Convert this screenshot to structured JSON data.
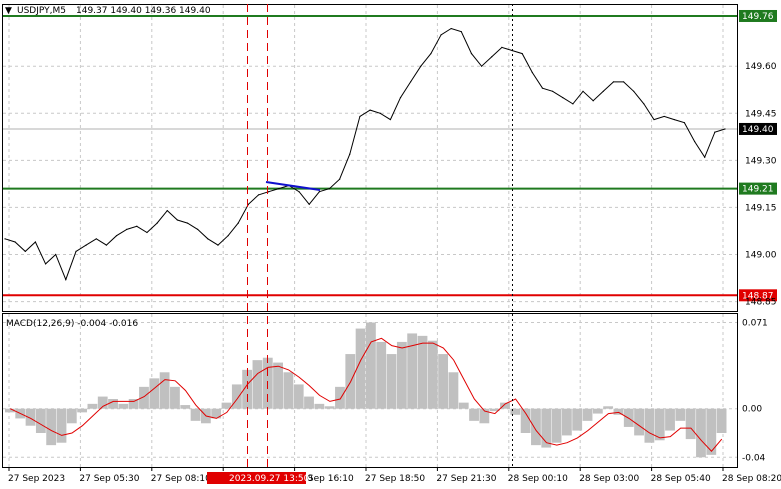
{
  "header": {
    "symbol_label": "USDJPY,M5",
    "ohlc": "149.37 149.40 149.36 149.40",
    "macd_label": "MACD(12,26,9) -0.004 -0.016"
  },
  "price_axis": {
    "ticks": [
      "149.60",
      "149.45",
      "149.30",
      "149.15",
      "149.00",
      "148.85"
    ],
    "tick_values": [
      149.6,
      149.45,
      149.3,
      149.15,
      149.0,
      148.85
    ],
    "range": [
      148.82,
      149.795
    ]
  },
  "macd_axis": {
    "ticks": [
      "0.071",
      "0.00",
      "-0.04"
    ],
    "tick_values": [
      0.071,
      0.0,
      -0.04
    ],
    "range": [
      -0.048,
      0.078
    ]
  },
  "levels": [
    {
      "label": "149.76",
      "value": 149.76,
      "color": "#1f7a1f"
    },
    {
      "label": "149.40",
      "value": 149.4,
      "color": "#000000"
    },
    {
      "label": "149.21",
      "value": 149.21,
      "color": "#1f7a1f"
    },
    {
      "label": "148.87",
      "value": 148.87,
      "color": "#e00000"
    }
  ],
  "time_axis": {
    "labels": [
      "27 Sep 2023",
      "27 Sep 05:30",
      "27 Sep 08:10",
      "27 Sep 202",
      "27 Sep 16:10",
      "27 Sep 18:50",
      "27 Sep 21:30",
      "28 Sep 00:10",
      "28 Sep 03:00",
      "28 Sep 05:40",
      "28 Sep 08:20"
    ],
    "highlight_label": "2023.09.27 13:50",
    "trailing_label": "0"
  },
  "colors": {
    "price_line": "#000000",
    "trendline": "#1010cc",
    "support_resistance": "#1f7a1f",
    "stop_level": "#e00000",
    "histogram": "#c0c0c0",
    "signal": "#e00000",
    "grid": "#c8c8c8"
  },
  "chart_data": [
    {
      "type": "line",
      "title": "USDJPY,M5",
      "x_labels": [
        "27 Sep 2023",
        "27 Sep 05:30",
        "27 Sep 08:10",
        "27 Sep 202",
        "27 Sep 16:10",
        "27 Sep 18:50",
        "27 Sep 21:30",
        "28 Sep 00:10",
        "28 Sep 03:00",
        "28 Sep 05:40",
        "28 Sep 08:20"
      ],
      "series": [
        {
          "name": "USDJPY,M5",
          "values": [
            149.05,
            149.04,
            149.01,
            149.04,
            148.97,
            149.0,
            148.92,
            149.01,
            149.03,
            149.05,
            149.03,
            149.06,
            149.08,
            149.09,
            149.07,
            149.1,
            149.14,
            149.11,
            149.1,
            149.08,
            149.05,
            149.03,
            149.06,
            149.1,
            149.16,
            149.19,
            149.2,
            149.21,
            149.22,
            149.2,
            149.16,
            149.2,
            149.21,
            149.24,
            149.32,
            149.44,
            149.46,
            149.45,
            149.43,
            149.5,
            149.55,
            149.6,
            149.64,
            149.7,
            149.72,
            149.71,
            149.64,
            149.6,
            149.63,
            149.66,
            149.65,
            149.64,
            149.58,
            149.53,
            149.52,
            149.5,
            149.48,
            149.52,
            149.49,
            149.52,
            149.55,
            149.55,
            149.52,
            149.48,
            149.43,
            149.44,
            149.43,
            149.42,
            149.36,
            149.31,
            149.39,
            149.4
          ]
        }
      ],
      "levels": [
        149.76,
        149.4,
        149.21,
        148.87
      ],
      "ylim": [
        148.82,
        149.795
      ],
      "grid": true
    },
    {
      "type": "bar",
      "title": "MACD(12,26,9)",
      "series": [
        {
          "name": "MACD(12,26,9)",
          "values": [
            -0.003,
            -0.008,
            -0.014,
            -0.02,
            -0.03,
            -0.028,
            -0.012,
            -0.003,
            0.004,
            0.01,
            0.008,
            0.004,
            0.008,
            0.018,
            0.025,
            0.03,
            0.018,
            0.003,
            -0.01,
            -0.012,
            -0.008,
            0.005,
            0.02,
            0.032,
            0.04,
            0.042,
            0.038,
            0.03,
            0.02,
            0.01,
            0.004,
            0.002,
            0.018,
            0.045,
            0.066,
            0.071,
            0.055,
            0.045,
            0.055,
            0.062,
            0.06,
            0.056,
            0.045,
            0.03,
            0.005,
            -0.01,
            -0.012,
            -0.002,
            0.005,
            -0.005,
            -0.02,
            -0.03,
            -0.032,
            -0.028,
            -0.022,
            -0.018,
            -0.01,
            -0.004,
            0.002,
            -0.005,
            -0.015,
            -0.022,
            -0.028,
            -0.026,
            -0.018,
            -0.01,
            -0.025,
            -0.04,
            -0.038,
            -0.02
          ]
        },
        {
          "name": "Signal",
          "values": [
            0.0,
            -0.004,
            -0.008,
            -0.013,
            -0.018,
            -0.022,
            -0.02,
            -0.014,
            -0.006,
            0.002,
            0.006,
            0.006,
            0.006,
            0.01,
            0.017,
            0.024,
            0.023,
            0.015,
            0.003,
            -0.006,
            -0.008,
            -0.003,
            0.008,
            0.02,
            0.029,
            0.034,
            0.035,
            0.032,
            0.026,
            0.019,
            0.011,
            0.006,
            0.008,
            0.022,
            0.04,
            0.055,
            0.058,
            0.052,
            0.05,
            0.052,
            0.054,
            0.054,
            0.05,
            0.04,
            0.024,
            0.008,
            -0.002,
            -0.004,
            0.004,
            0.008,
            -0.004,
            -0.018,
            -0.028,
            -0.03,
            -0.028,
            -0.024,
            -0.018,
            -0.011,
            -0.004,
            -0.003,
            -0.008,
            -0.014,
            -0.02,
            -0.024,
            -0.023,
            -0.016,
            -0.016,
            -0.026,
            -0.035,
            -0.025
          ]
        }
      ],
      "ylim": [
        -0.048,
        0.078
      ],
      "grid": true
    }
  ]
}
